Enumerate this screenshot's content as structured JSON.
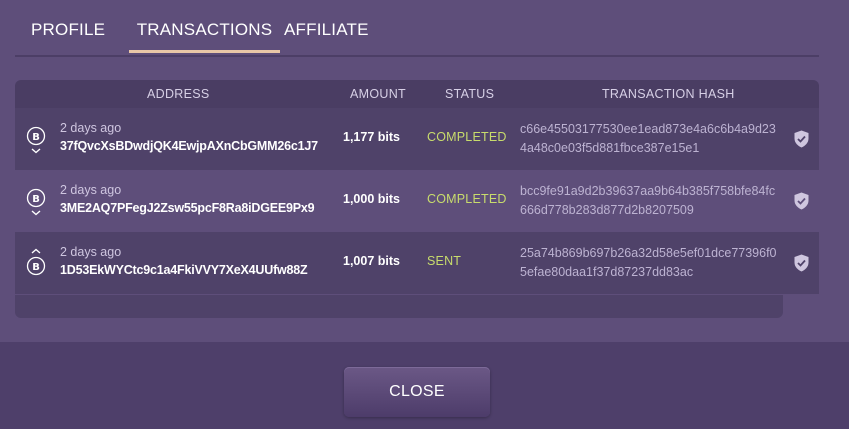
{
  "tabs": [
    {
      "label": "PROFILE"
    },
    {
      "label": "TRANSACTIONS"
    },
    {
      "label": "AFFILIATE"
    }
  ],
  "table": {
    "headers": {
      "address": "ADDRESS",
      "amount": "AMOUNT",
      "status": "STATUS",
      "hash": "TRANSACTION HASH"
    },
    "rows": [
      {
        "direction": "incoming",
        "icon": "bitcoin-receive-icon",
        "time": "2 days ago",
        "address": "37fQvcXsBDwdjQK4EwjpAXnCbGMM26c1J7",
        "amount": "1,177 bits",
        "status": "COMPLETED",
        "hash": "c66e45503177530ee1ead873e4a6c6b4a9d234a48c0e03f5d881fbce387e15e1"
      },
      {
        "direction": "incoming",
        "icon": "bitcoin-receive-icon",
        "time": "2 days ago",
        "address": "3ME2AQ7PFegJ2Zsw55pcF8Ra8iDGEE9Px9",
        "amount": "1,000 bits",
        "status": "COMPLETED",
        "hash": "bcc9fe91a9d2b39637aa9b64b385f758bfe84fc666d778b283d877d2b8207509"
      },
      {
        "direction": "outgoing",
        "icon": "bitcoin-send-icon",
        "time": "2 days ago",
        "address": "1D53EkWYCtc9c1a4FkiVVY7XeX4UUfw88Z",
        "amount": "1,007 bits",
        "status": "SENT",
        "hash": "25a74b869b697b26a32d58e5ef01dce77396f05efae80daa1f37d87237dd83ac"
      }
    ]
  },
  "close_label": "CLOSE",
  "colors": {
    "accent_underline": "#e9c7a7",
    "status_green": "#c8dc6c",
    "background": "#5e4e7a"
  }
}
